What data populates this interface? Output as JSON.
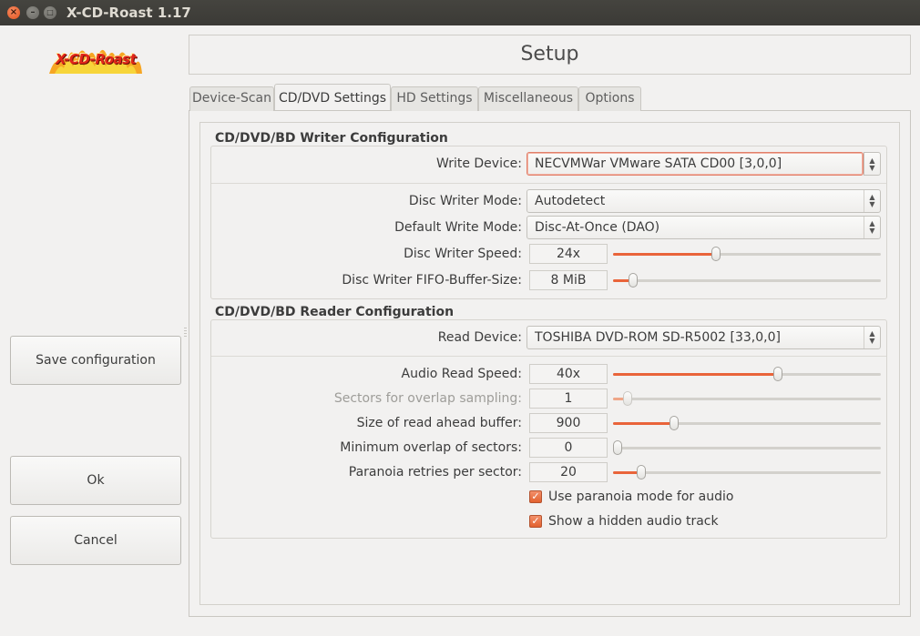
{
  "window": {
    "title": "X-CD-Roast 1.17"
  },
  "logo": {
    "text": "X-CD-Roast"
  },
  "sidebar": {
    "save_label": "Save configuration",
    "ok_label": "Ok",
    "cancel_label": "Cancel"
  },
  "banner": {
    "title": "Setup"
  },
  "tabs": [
    {
      "label": "Device-Scan",
      "active": false
    },
    {
      "label": "CD/DVD Settings",
      "active": true
    },
    {
      "label": "HD Settings",
      "active": false
    },
    {
      "label": "Miscellaneous",
      "active": false
    },
    {
      "label": "Options",
      "active": false
    }
  ],
  "writer": {
    "section_title": "CD/DVD/BD Writer Configuration",
    "write_device_label": "Write Device:",
    "write_device_value": "NECVMWar VMware SATA CD00 [3,0,0]",
    "mode_label": "Disc Writer Mode:",
    "mode_value": "Autodetect",
    "default_mode_label": "Default Write Mode:",
    "default_mode_value": "Disc-At-Once (DAO)",
    "speed_label": "Disc Writer Speed:",
    "speed_value": "24x",
    "speed_level": 0.38,
    "fifo_label": "Disc Writer FIFO-Buffer-Size:",
    "fifo_value": "8 MiB",
    "fifo_level": 0.06
  },
  "reader": {
    "section_title": "CD/DVD/BD Reader Configuration",
    "read_device_label": "Read Device:",
    "read_device_value": "TOSHIBA  DVD-ROM SD-R5002 [33,0,0]",
    "audio_speed_label": "Audio Read Speed:",
    "audio_speed_value": "40x",
    "audio_speed_level": 0.62,
    "overlap_sampling_label": "Sectors for overlap sampling:",
    "overlap_sampling_value": "1",
    "overlap_sampling_level": 0.04,
    "readahead_label": "Size of read ahead buffer:",
    "readahead_value": "900",
    "readahead_level": 0.22,
    "min_overlap_label": "Minimum overlap of sectors:",
    "min_overlap_value": "0",
    "min_overlap_level": 0.0,
    "retries_label": "Paranoia retries per sector:",
    "retries_value": "20",
    "retries_level": 0.09,
    "paranoia_label": "Use paranoia mode for audio",
    "paranoia_checked": true,
    "hidden_track_label": "Show a hidden audio track",
    "hidden_track_checked": true
  },
  "colors": {
    "accent": "#e9643a",
    "titlebar": "#3b3a36",
    "close_button": "#e2531d"
  }
}
